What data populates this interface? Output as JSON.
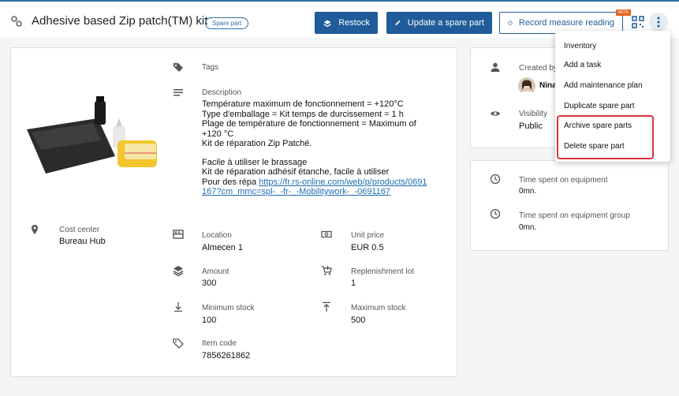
{
  "header": {
    "title": "Adhesive based Zip patch(TM) kit",
    "badge": "Spare part",
    "buttons": {
      "restock": "Restock",
      "update": "Update a spare part",
      "record": "Record measure reading"
    },
    "beta": "BETA"
  },
  "menu": {
    "items": [
      "Inventory",
      "Add a task",
      "Add maintenance plan",
      "Duplicate spare part",
      "Archive spare parts",
      "Delete spare part"
    ]
  },
  "details": {
    "tags_label": "Tags",
    "description_label": "Description",
    "description_lines": [
      "Température maximum de fonctionnement = +120°C",
      "Type d'emballage = Kit temps de durcissement = 1 h",
      "Plage de température de fonctionnement = Maximum of",
      "+120 °C",
      "Kit de réparation Zip Patché."
    ],
    "description_lines2": [
      "Facile à utiliser le brassage",
      "Kit de réparation adhésif étanche, facile à utiliser"
    ],
    "description_link_prefix": "Pour des répa ",
    "description_link": "https://fr.rs-online.com/web/p/products/0691167?cm_mmc=spl-_-fr-_-Mobilitywork-_-0691167",
    "cost_center_label": "Cost center",
    "cost_center_value": "Bureau Hub",
    "location_label": "Location",
    "location_value": "Almecen 1",
    "unit_price_label": "Unit price",
    "unit_price_value": "EUR 0.5",
    "amount_label": "Amount",
    "amount_value": "300",
    "replenishment_label": "Replenishment lot",
    "replenishment_value": "1",
    "min_stock_label": "Minimum stock",
    "min_stock_value": "100",
    "max_stock_label": "Maximum stock",
    "max_stock_value": "500",
    "item_code_label": "Item code",
    "item_code_value": "7856261862"
  },
  "side": {
    "created_by_label": "Created by",
    "created_by_value": "Nina",
    "visibility_label": "Visibility",
    "visibility_value": "Public",
    "time_equipment_label": "Time spent on equipment",
    "time_equipment_value": "0mn.",
    "time_group_label": "Time spent on equipment group",
    "time_group_value": "0mn."
  },
  "colors": {
    "primary": "#1f5c99",
    "accent": "#2c6fa8",
    "highlight": "#d9353a",
    "beta": "#e8621e"
  },
  "icons": [
    "settings-icon",
    "restock-icon",
    "pencil-icon",
    "gauge-icon",
    "qr-code-icon",
    "more-vert-icon",
    "tag-icon",
    "description-icon",
    "location-pin-icon",
    "shelf-icon",
    "cash-icon",
    "layers-icon",
    "cart-icon",
    "min-stock-icon",
    "max-stock-icon",
    "code-tag-icon",
    "person-icon",
    "eye-icon",
    "clock-icon"
  ]
}
